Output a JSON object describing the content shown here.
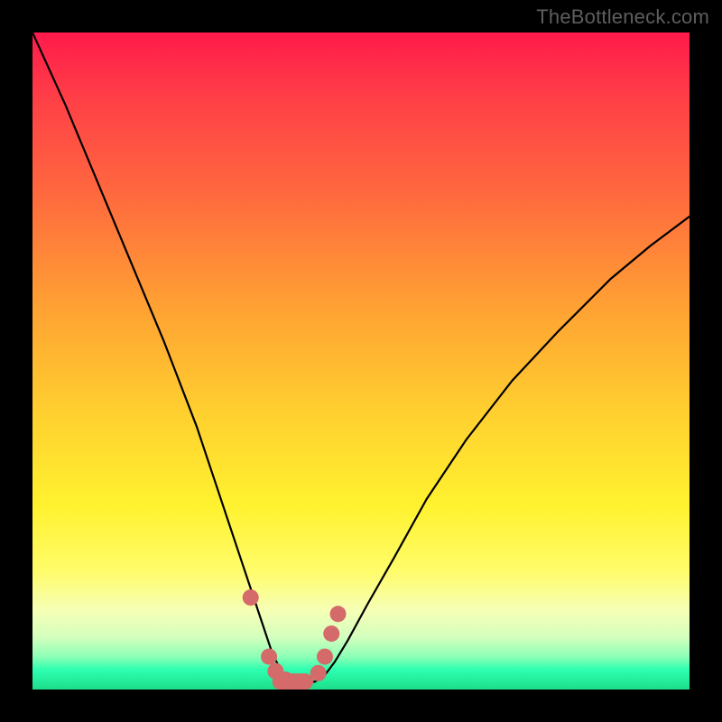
{
  "watermark": "TheBottleneck.com",
  "chart_data": {
    "type": "line",
    "title": "",
    "xlabel": "",
    "ylabel": "",
    "xlim": [
      0,
      1
    ],
    "ylim": [
      0,
      1
    ],
    "series": [
      {
        "name": "curve",
        "x": [
          0.0,
          0.05,
          0.1,
          0.15,
          0.2,
          0.25,
          0.28,
          0.3,
          0.32,
          0.34,
          0.355,
          0.365,
          0.375,
          0.385,
          0.395,
          0.41,
          0.43,
          0.445,
          0.46,
          0.48,
          0.51,
          0.55,
          0.6,
          0.66,
          0.73,
          0.8,
          0.88,
          0.94,
          1.0
        ],
        "y": [
          1.0,
          0.89,
          0.77,
          0.65,
          0.53,
          0.4,
          0.31,
          0.25,
          0.19,
          0.13,
          0.085,
          0.055,
          0.035,
          0.02,
          0.012,
          0.01,
          0.012,
          0.022,
          0.042,
          0.075,
          0.13,
          0.2,
          0.29,
          0.38,
          0.47,
          0.545,
          0.625,
          0.675,
          0.72
        ]
      },
      {
        "name": "trough-markers",
        "x": [
          0.332,
          0.36,
          0.37,
          0.385,
          0.4,
          0.415,
          0.435,
          0.445,
          0.455,
          0.465
        ],
        "y": [
          0.14,
          0.05,
          0.028,
          0.015,
          0.012,
          0.012,
          0.025,
          0.05,
          0.085,
          0.115
        ]
      }
    ],
    "colors": {
      "curve_stroke": "#000000",
      "marker_fill": "#d46a6a"
    }
  }
}
